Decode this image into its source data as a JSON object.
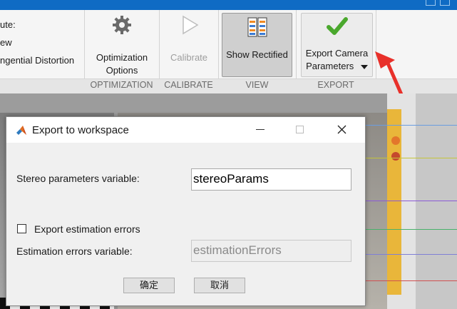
{
  "ribbon": {
    "left_items": [
      "ute:",
      "ew",
      "ngential Distortion"
    ],
    "buttons": {
      "optimization_options": "Optimization Options",
      "calibrate": "Calibrate",
      "show_rectified": "Show Rectified",
      "export_line1": "Export Camera",
      "export_line2": "Parameters"
    },
    "groups": {
      "optimization": "OPTIMIZATION",
      "calibrate": "CALIBRATE",
      "view": "VIEW",
      "export": "EXPORT"
    }
  },
  "dialog": {
    "title": "Export to workspace",
    "stereo_label": "Stereo parameters variable:",
    "stereo_value": "stereoParams",
    "export_errors_label": "Export estimation errors",
    "export_errors_checked": false,
    "errors_label": "Estimation errors variable:",
    "errors_value": "estimationErrors",
    "ok_label": "确定",
    "cancel_label": "取消"
  },
  "colors": {
    "titlebar": "#0f6bc4",
    "annotation_arrow": "#e8302a"
  }
}
